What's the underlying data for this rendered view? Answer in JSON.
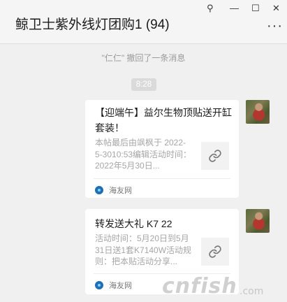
{
  "chat": {
    "title": "鲸卫士紫外线灯团购1 (94)",
    "pin_glyph": "⚲",
    "minimize_glyph": "—",
    "maximize_glyph": "☐",
    "close_glyph": "✕",
    "more_glyph": "···"
  },
  "system": {
    "recall_text": "\"仁仁\" 撤回了一条消息",
    "timestamp": "8:28"
  },
  "messages": [
    {
      "title": "【迎端午】益尔生物顶贴送开缸套装！",
      "desc": "本帖最后由飒枫于 2022-5-3010:53编辑活动时间：2022年5月30日...",
      "source": "海友网",
      "thumb_icon": "link-icon"
    },
    {
      "title": "转发送大礼 K7 22",
      "desc": "活动时间：5月20日到5月31日送1套K7140W活动规则：把本贴活动分享...",
      "source": "海友网",
      "thumb_icon": "link-icon"
    }
  ],
  "watermark": {
    "text": "cnfish",
    "suffix": ".com"
  },
  "colors": {
    "background": "#f0f0f0",
    "card": "#ffffff",
    "muted_text": "#a6a6a6",
    "source_logo": "#1f6fb3"
  }
}
